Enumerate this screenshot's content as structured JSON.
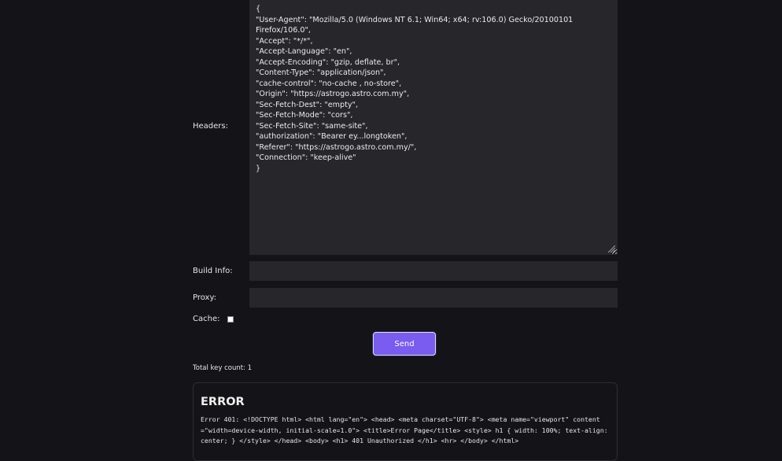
{
  "form": {
    "headers_label": "Headers:",
    "headers_value": "{\n\"User-Agent\": \"Mozilla/5.0 (Windows NT 6.1; Win64; x64; rv:106.0) Gecko/20100101 Firefox/106.0\",\n\"Accept\": \"*/*\",\n\"Accept-Language\": \"en\",\n\"Accept-Encoding\": \"gzip, deflate, br\",\n\"Content-Type\": \"application/json\",\n\"cache-control\": \"no-cache , no-store\",\n\"Origin\": \"https://astrogo.astro.com.my\",\n\"Sec-Fetch-Dest\": \"empty\",\n\"Sec-Fetch-Mode\": \"cors\",\n\"Sec-Fetch-Site\": \"same-site\",\n\"authorization\": \"Bearer ey...longtoken\",\n\"Referer\": \"https://astrogo.astro.com.my/\",\n\"Connection\": \"keep-alive\"\n}",
    "build_info_label": "Build Info:",
    "build_info_value": "",
    "proxy_label": "Proxy:",
    "proxy_value": "",
    "cache_label": "Cache:",
    "cache_checked": false,
    "send_label": "Send"
  },
  "status": {
    "total_key_count": "Total key count: 1"
  },
  "error": {
    "title": "ERROR",
    "message": "Error 401: <!DOCTYPE html> <html lang=\"en\"> <head> <meta charset=\"UTF-8\"> <meta name=\"viewport\" content=\"width=device-width, initial-scale=1.0\"> <title>Error Page</title> <style> h1 { width: 100%; text-align: center; } </style> </head> <body> <h1> 401 Unauthorized </h1> <hr> </body> </html>"
  },
  "colors": {
    "background": "#141418",
    "field": "#26262b",
    "accent": "#7a5cf0"
  }
}
